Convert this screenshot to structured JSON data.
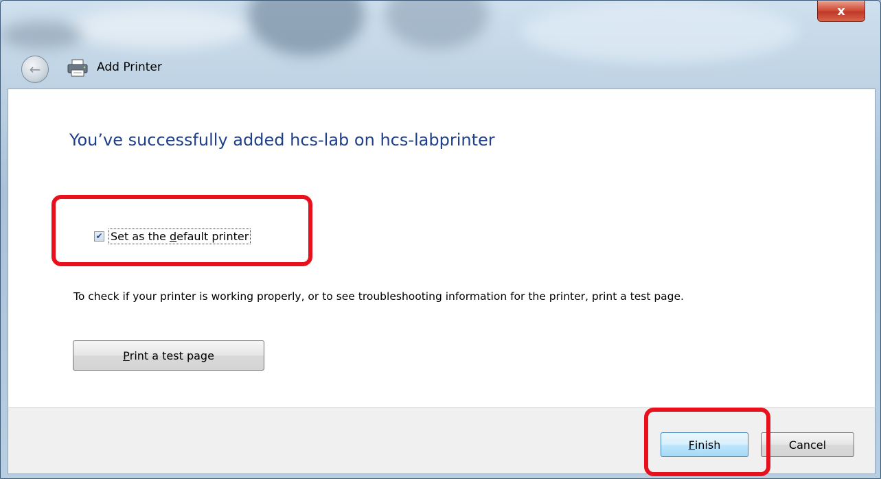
{
  "window": {
    "title": "Add Printer",
    "close_label": "x"
  },
  "dialog": {
    "heading": "You’ve successfully added hcs-lab on hcs-labprinter",
    "default_checkbox": {
      "checked": true,
      "label_pre": "Set as the ",
      "label_accel": "d",
      "label_post": "efault printer"
    },
    "description": "To check if your printer is working properly, or to see troubleshooting information for the printer, print a test page.",
    "test_button": {
      "accel": "P",
      "rest": "rint a test page"
    }
  },
  "footer": {
    "finish_accel": "F",
    "finish_rest": "inish",
    "cancel_label": "Cancel"
  },
  "colors": {
    "heading": "#1e3f8a",
    "highlight": "#e8101c"
  }
}
